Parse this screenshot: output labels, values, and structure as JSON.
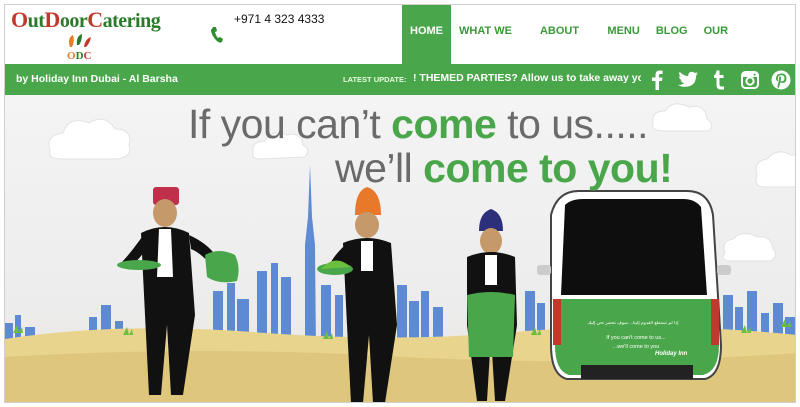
{
  "brand": {
    "name_parts": [
      "O",
      "ut",
      "D",
      "oor",
      "C",
      "atering"
    ],
    "mark": "ODC"
  },
  "header": {
    "phone": "+971 4 323 4333"
  },
  "nav": {
    "items": [
      {
        "label": "HOME",
        "active": true
      },
      {
        "label": "WHAT WE DO"
      },
      {
        "label": "ABOUT US"
      },
      {
        "label": "MENU"
      },
      {
        "label": "BLOG"
      },
      {
        "label": "OUR SUCCESSES"
      }
    ]
  },
  "bar": {
    "location": "by Holiday Inn Dubai - Al Barsha",
    "latest_label": "LATEST UPDATE:",
    "ticker": "! THEMED PARTIES? Allow us to take away your headache"
  },
  "social": [
    "facebook-icon",
    "twitter-icon",
    "tumblr-icon",
    "instagram-icon",
    "pinterest-icon"
  ],
  "hero": {
    "line1_a": "If you can’t ",
    "line1_b": "come",
    "line1_c": " to us.....",
    "line2_a": "we’ll ",
    "line2_b": "come to you!",
    "van_text_1": "If you can't come to us...",
    "van_text_2": "...we'll come to you",
    "van_brand": "Holiday Inn",
    "van_arabic": "إذا لم تستطع القدوم إلينا... سوف نحضر نحن إليك"
  },
  "colors": {
    "green": "#4aa64a",
    "logo_green": "#2a7a2a",
    "logo_red": "#c0392b",
    "text_gray": "#6a6a6a"
  }
}
